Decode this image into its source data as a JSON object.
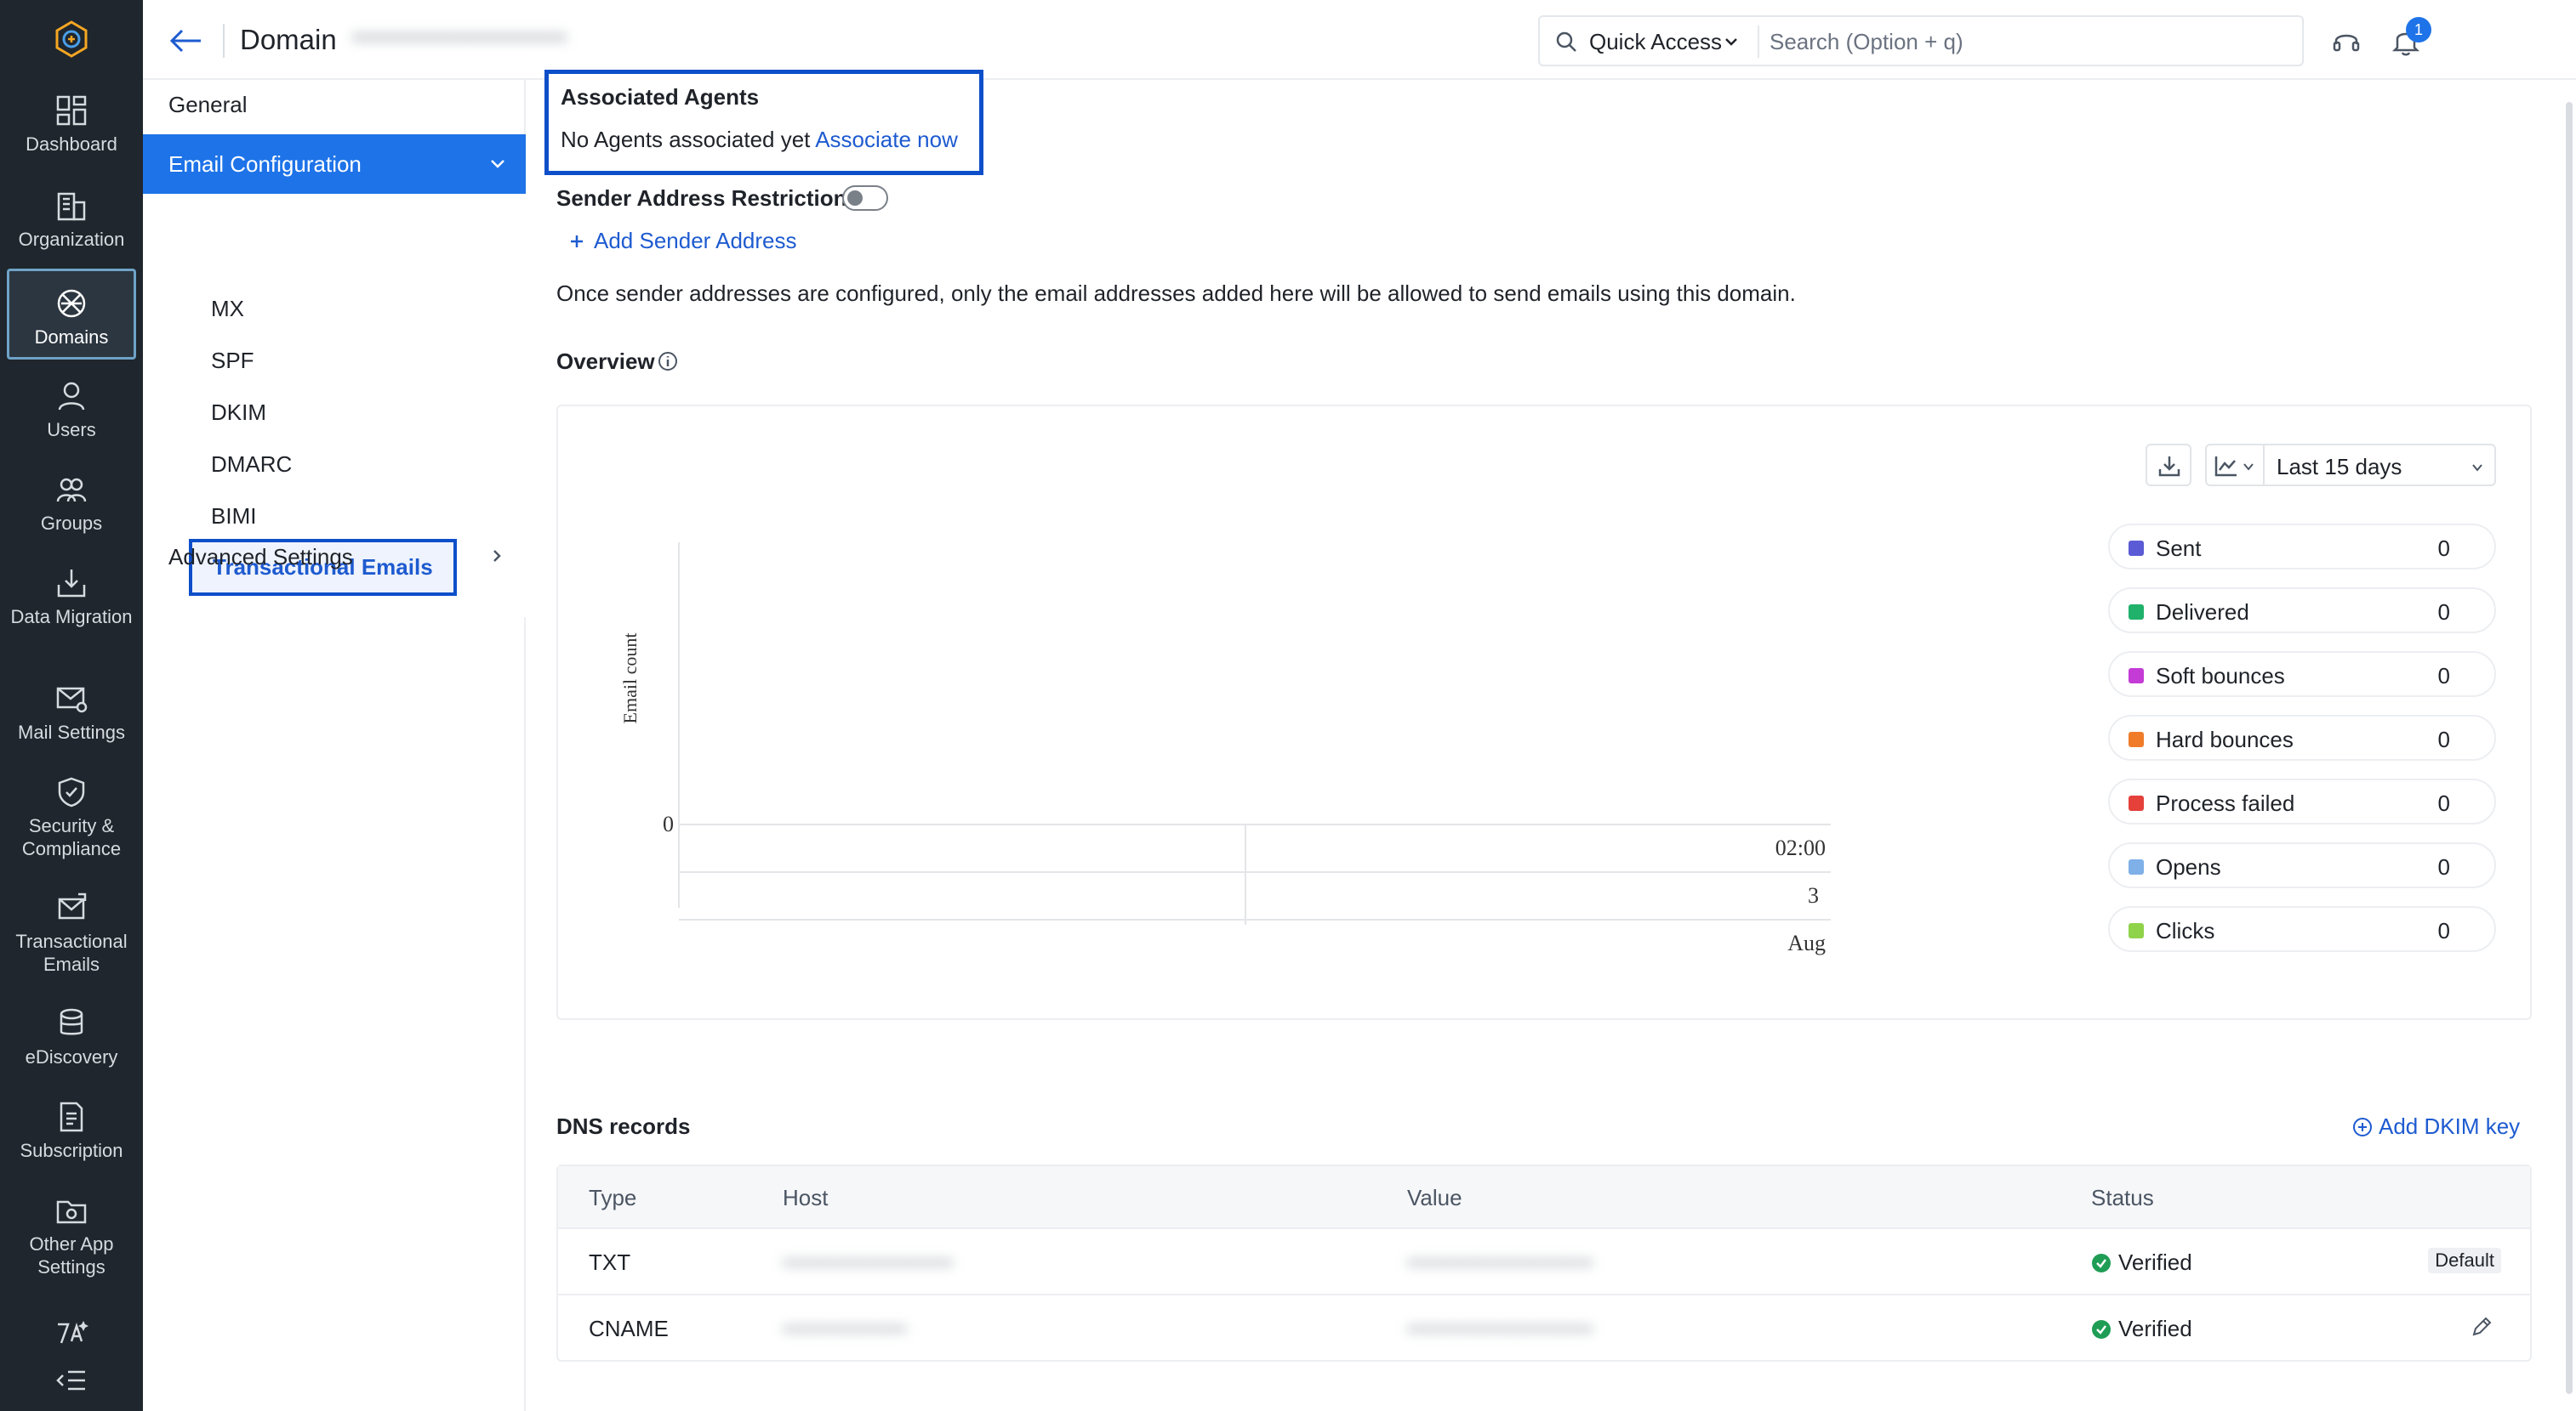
{
  "rail": {
    "items": [
      {
        "label": "Dashboard",
        "icon": "dashboard-icon"
      },
      {
        "label": "Organization",
        "icon": "organization-icon"
      },
      {
        "label": "Domains",
        "icon": "domains-icon"
      },
      {
        "label": "Users",
        "icon": "users-icon"
      },
      {
        "label": "Groups",
        "icon": "groups-icon"
      },
      {
        "label": "Data Migration",
        "icon": "data-migration-icon"
      },
      {
        "label": "Mail Settings",
        "icon": "mail-settings-icon"
      },
      {
        "label": "Security & Compliance",
        "icon": "security-icon"
      },
      {
        "label": "Transactional Emails",
        "icon": "transactional-emails-icon"
      },
      {
        "label": "eDiscovery",
        "icon": "ediscovery-icon"
      },
      {
        "label": "Subscription",
        "icon": "subscription-icon"
      },
      {
        "label": "Other App Settings",
        "icon": "other-app-settings-icon"
      }
    ],
    "active": "Domains"
  },
  "header": {
    "title": "Domain",
    "domain_name": "••••••••••••••••••••••••",
    "quick_access": "Quick Access",
    "search_placeholder": "Search (Option + q)",
    "notification_count": "1"
  },
  "submenu": {
    "general": "General",
    "email_configuration": "Email Configuration",
    "items": [
      "MX",
      "SPF",
      "DKIM",
      "DMARC",
      "BIMI",
      "Transactional Emails"
    ],
    "active_item": "Transactional Emails",
    "advanced_settings": "Advanced Settings"
  },
  "main": {
    "associated_agents_title": "Associated Agents",
    "no_agents_text": "No Agents associated yet",
    "associate_now": "Associate now",
    "sender_restriction_label": "Sender Address Restriction",
    "sender_restriction_enabled": false,
    "add_sender_address": "Add Sender Address",
    "sender_info": "Once sender addresses are configured, only the email addresses added here will be allowed to send emails using this domain.",
    "overview_title": "Overview",
    "range_label": "Last 15 days",
    "chart": {
      "ylabel": "Email count",
      "y_tick": "0",
      "x_time": "02:00",
      "x_day": "3",
      "x_month": "Aug"
    },
    "legend": [
      {
        "name": "Sent",
        "value": "0",
        "color": "#5b5bd6"
      },
      {
        "name": "Delivered",
        "value": "0",
        "color": "#20b26b"
      },
      {
        "name": "Soft bounces",
        "value": "0",
        "color": "#c43bd6"
      },
      {
        "name": "Hard bounces",
        "value": "0",
        "color": "#f07c2a"
      },
      {
        "name": "Process failed",
        "value": "0",
        "color": "#e5403a"
      },
      {
        "name": "Opens",
        "value": "0",
        "color": "#7fb0e8"
      },
      {
        "name": "Clicks",
        "value": "0",
        "color": "#8fd34a"
      }
    ],
    "dns_title": "DNS records",
    "add_dkim": "Add DKIM key",
    "dns_columns": [
      "Type",
      "Host",
      "Value",
      "Status"
    ],
    "dns_rows": [
      {
        "type": "TXT",
        "host": "••••••••••••••••••••••",
        "value": "••••••••••••••••••••••••",
        "status": "Verified",
        "badge": "Default"
      },
      {
        "type": "CNAME",
        "host": "••••••••••••••••",
        "value": "••••••••••••••••••••••••",
        "status": "Verified",
        "badge": ""
      }
    ]
  },
  "chart_data": {
    "type": "line",
    "title": "",
    "xlabel": "",
    "ylabel": "Email count",
    "x": [
      "02:00 3 Aug"
    ],
    "series": [
      {
        "name": "Sent",
        "values": [
          0
        ]
      },
      {
        "name": "Delivered",
        "values": [
          0
        ]
      },
      {
        "name": "Soft bounces",
        "values": [
          0
        ]
      },
      {
        "name": "Hard bounces",
        "values": [
          0
        ]
      },
      {
        "name": "Process failed",
        "values": [
          0
        ]
      },
      {
        "name": "Opens",
        "values": [
          0
        ]
      },
      {
        "name": "Clicks",
        "values": [
          0
        ]
      }
    ],
    "ylim": [
      0,
      0
    ],
    "legend": "right"
  }
}
